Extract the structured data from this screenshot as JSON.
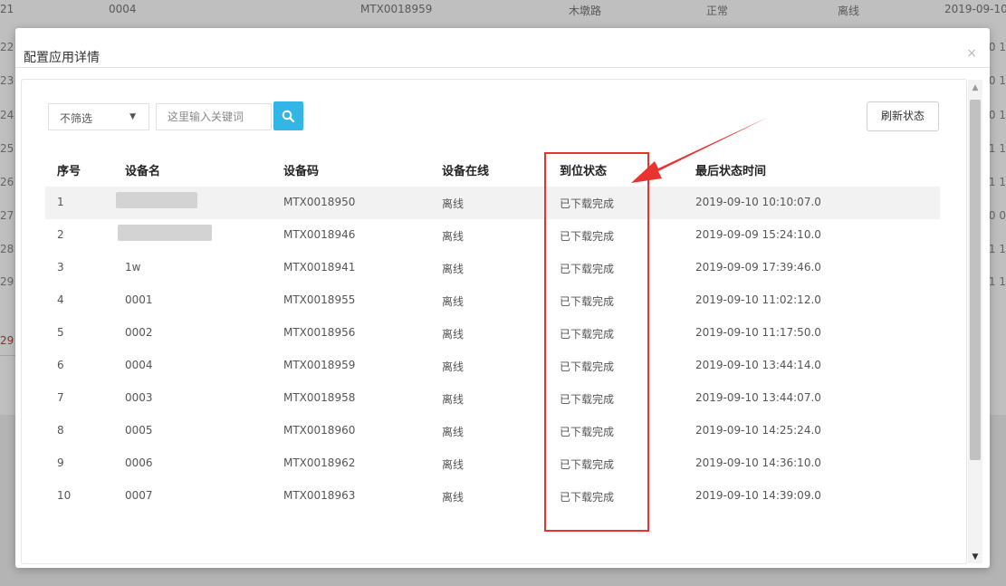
{
  "background": {
    "top_row": {
      "index": "21",
      "name": "0004",
      "code": "MTX0018959",
      "location": "木墩路",
      "state": "正常",
      "online": "离线",
      "time": "2019-09-10 1"
    },
    "left_numbers": [
      "22",
      "23",
      "24",
      "25",
      "26",
      "27",
      "28",
      "29",
      "29"
    ],
    "right_values": [
      "0 1",
      "0 1",
      "0 1",
      "1 1",
      "1 1",
      "0 0",
      "1 1",
      "1 1"
    ]
  },
  "modal": {
    "title": "配置应用详情",
    "close_label": "×",
    "toolbar": {
      "filter_value": "不筛选",
      "search_placeholder": "这里输入关键词",
      "refresh_label": "刷新状态"
    },
    "table": {
      "headers": [
        "序号",
        "设备名",
        "设备码",
        "设备在线",
        "到位状态",
        "最后状态时间"
      ],
      "rows": [
        {
          "index": "1",
          "name": "",
          "code": "MTX0018950",
          "online": "离线",
          "status": "已下载完成",
          "time": "2019-09-10 10:10:07.0"
        },
        {
          "index": "2",
          "name": "",
          "code": "MTX0018946",
          "online": "离线",
          "status": "已下载完成",
          "time": "2019-09-09 15:24:10.0"
        },
        {
          "index": "3",
          "name": "1w",
          "code": "MTX0018941",
          "online": "离线",
          "status": "已下载完成",
          "time": "2019-09-09 17:39:46.0"
        },
        {
          "index": "4",
          "name": "0001",
          "code": "MTX0018955",
          "online": "离线",
          "status": "已下载完成",
          "time": "2019-09-10 11:02:12.0"
        },
        {
          "index": "5",
          "name": "0002",
          "code": "MTX0018956",
          "online": "离线",
          "status": "已下载完成",
          "time": "2019-09-10 11:17:50.0"
        },
        {
          "index": "6",
          "name": "0004",
          "code": "MTX0018959",
          "online": "离线",
          "status": "已下载完成",
          "time": "2019-09-10 13:44:14.0"
        },
        {
          "index": "7",
          "name": "0003",
          "code": "MTX0018958",
          "online": "离线",
          "status": "已下载完成",
          "time": "2019-09-10 13:44:07.0"
        },
        {
          "index": "8",
          "name": "0005",
          "code": "MTX0018960",
          "online": "离线",
          "status": "已下载完成",
          "time": "2019-09-10 14:25:24.0"
        },
        {
          "index": "9",
          "name": "0006",
          "code": "MTX0018962",
          "online": "离线",
          "status": "已下载完成",
          "time": "2019-09-10 14:36:10.0"
        },
        {
          "index": "10",
          "name": "0007",
          "code": "MTX0018963",
          "online": "离线",
          "status": "已下载完成",
          "time": "2019-09-10 14:39:09.0"
        }
      ]
    }
  },
  "icons": {
    "search": "search-icon",
    "select_arrow": "caret-down-icon",
    "close": "close-icon",
    "scroll_up": "scroll-up-icon",
    "scroll_down": "scroll-down-icon"
  },
  "colors": {
    "accent": "#33b5e5",
    "annotation": "#e8332e",
    "row_highlight": "#f2f2f2"
  }
}
